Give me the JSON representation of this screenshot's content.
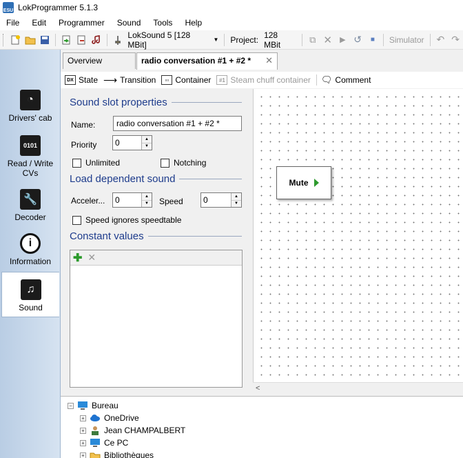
{
  "window": {
    "title": "LokProgrammer 5.1.3",
    "icon_text": "ESU"
  },
  "menu": [
    "File",
    "Edit",
    "Programmer",
    "Sound",
    "Tools",
    "Help"
  ],
  "toolbar": {
    "decoder_combo": "LokSound 5 [128 MBit]",
    "project_label": "Project:",
    "project_value": "128 MBit",
    "simulator_label": "Simulator"
  },
  "leftnav": [
    {
      "label": "Drivers' cab",
      "icon": "drivers-cab-icon"
    },
    {
      "label": "Read / Write CVs",
      "icon": "read-write-cvs-icon"
    },
    {
      "label": "Decoder",
      "icon": "wrench-icon"
    },
    {
      "label": "Information",
      "icon": "info-icon"
    },
    {
      "label": "Sound",
      "icon": "music-note-icon"
    }
  ],
  "tabs": [
    {
      "label": "Overview"
    },
    {
      "label": "radio conversation #1 + #2 *"
    }
  ],
  "editor_toolbar": {
    "state_icon": "DX",
    "state": "State",
    "transition": "Transition",
    "container": "Container",
    "steam_chuff": "Steam chuff container",
    "comment": "Comment"
  },
  "sound_slot": {
    "title": "Sound slot properties",
    "name_label": "Name:",
    "name_value": "radio conversation #1 + #2 *",
    "priority_label": "Priority",
    "priority_value": "0",
    "unlimited_label": "Unlimited",
    "notching_label": "Notching"
  },
  "load_dependent": {
    "title": "Load dependent sound",
    "accel_label": "Acceler...",
    "accel_value": "0",
    "speed_label": "Speed",
    "speed_value": "0",
    "speed_ignores_label": "Speed ignores speedtable"
  },
  "constant_values": {
    "title": "Constant values"
  },
  "canvas": {
    "state_label": "Mute"
  },
  "tree": [
    {
      "label": "Bureau",
      "icon": "desktop-icon"
    },
    {
      "label": "OneDrive",
      "icon": "cloud-icon"
    },
    {
      "label": "Jean CHAMPALBERT",
      "icon": "user-icon"
    },
    {
      "label": "Ce PC",
      "icon": "computer-icon"
    },
    {
      "label": "Bibliothèques",
      "icon": "library-icon"
    }
  ],
  "colors": {
    "section_title": "#1e3c8c",
    "nav_bg": "#c7d8ec",
    "state_arrow": "#2e9a2e"
  }
}
